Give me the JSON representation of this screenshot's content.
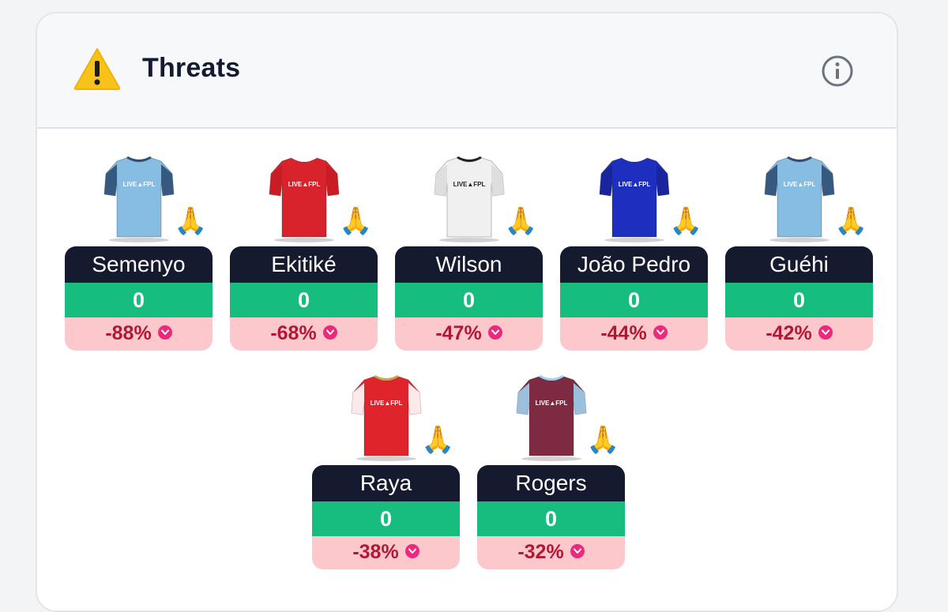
{
  "header": {
    "title": "Threats"
  },
  "icons": {
    "warning": "warning-triangle-icon",
    "info": "info-circle-icon",
    "emoji": "🙏"
  },
  "colors": {
    "name_bg": "#151a2e",
    "points_bg": "#17bd7f",
    "change_bg": "#fcc8cc",
    "change_text": "#b01834",
    "badge": "#ec2a7d"
  },
  "players": [
    {
      "name": "Semenyo",
      "points": "0",
      "change": "-88%",
      "kit": {
        "body": "#87bde3",
        "sleeve": "#2e4f73",
        "trim": "#2e4f73",
        "text": "#ffffff"
      }
    },
    {
      "name": "Ekitiké",
      "points": "0",
      "change": "-68%",
      "kit": {
        "body": "#d8232c",
        "sleeve": "#c81d26",
        "trim": "#ffffff",
        "text": "#ffffff"
      }
    },
    {
      "name": "Wilson",
      "points": "0",
      "change": "-47%",
      "kit": {
        "body": "#f0f0f0",
        "sleeve": "#dcdcdc",
        "trim": "#222222",
        "text": "#222222"
      }
    },
    {
      "name": "João Pedro",
      "points": "0",
      "change": "-44%",
      "kit": {
        "body": "#1e2fbf",
        "sleeve": "#182598",
        "trim": "#ffffff",
        "text": "#ffffff"
      }
    },
    {
      "name": "Guéhi",
      "points": "0",
      "change": "-42%",
      "kit": {
        "body": "#87bde3",
        "sleeve": "#2e4f73",
        "trim": "#2e4f73",
        "text": "#ffffff"
      }
    },
    {
      "name": "Raya",
      "points": "0",
      "change": "-38%",
      "kit": {
        "body": "#e0242c",
        "sleeve": "#ffffff",
        "trim": "#c9a34a",
        "text": "#ffffff"
      }
    },
    {
      "name": "Rogers",
      "points": "0",
      "change": "-32%",
      "kit": {
        "body": "#7d2a42",
        "sleeve": "#9ed0ee",
        "trim": "#9ed0ee",
        "text": "#ffffff"
      }
    }
  ],
  "kit_sponsor": "LIVE▲FPL"
}
